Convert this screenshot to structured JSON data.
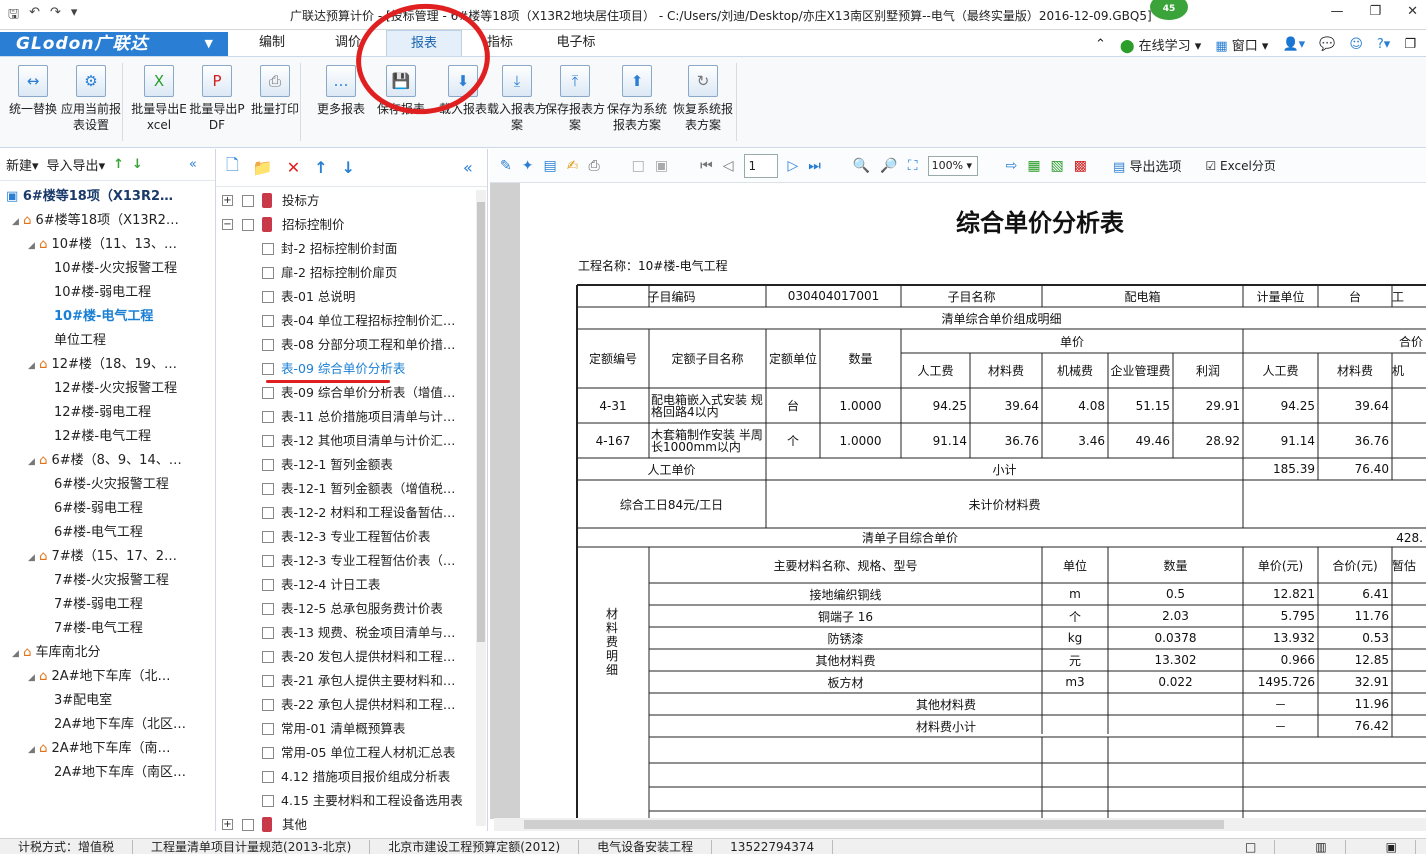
{
  "window": {
    "title": "广联达预算计价 - [投标管理 - 6#楼等18项（X13R2地块居住项目） - C:/Users/刘迪/Desktop/亦庄X13南区别墅预算--电气（最终实量版）2016-12-09.GBQ5]",
    "badge": "45"
  },
  "brand": {
    "logo": "GLodon广联达"
  },
  "menu": {
    "tabs": [
      "编制",
      "调价",
      "报表",
      "指标",
      "电子标"
    ],
    "active": "报表",
    "online": "在线学习",
    "window": "窗口"
  },
  "ribbon": {
    "buttons": [
      "统一替换",
      "应用当前报表设置",
      "批量导出Excel",
      "批量导出PDF",
      "批量打印",
      "更多报表",
      "保存报表",
      "载入报表",
      "载入报表方案",
      "保存报表方案",
      "保存为系统报表方案",
      "恢复系统报表方案"
    ]
  },
  "project_tree": {
    "toolbar": {
      "new": "新建",
      "import_export": "导入导出"
    },
    "root": "6#楼等18项（X13R2…",
    "nodes": [
      {
        "label": "6#楼等18项（X13R2…",
        "level": 1,
        "type": "home"
      },
      {
        "label": "10#楼（11、13、…",
        "level": 2,
        "type": "home"
      },
      {
        "label": "10#楼-火灾报警工程",
        "level": 3
      },
      {
        "label": "10#楼-弱电工程",
        "level": 3
      },
      {
        "label": "10#楼-电气工程",
        "level": 3,
        "selected": true
      },
      {
        "label": "单位工程",
        "level": 3
      },
      {
        "label": "12#楼（18、19、…",
        "level": 2,
        "type": "home"
      },
      {
        "label": "12#楼-火灾报警工程",
        "level": 3
      },
      {
        "label": "12#楼-弱电工程",
        "level": 3
      },
      {
        "label": "12#楼-电气工程",
        "level": 3
      },
      {
        "label": "6#楼（8、9、14、…",
        "level": 2,
        "type": "home"
      },
      {
        "label": "6#楼-火灾报警工程",
        "level": 3
      },
      {
        "label": "6#楼-弱电工程",
        "level": 3
      },
      {
        "label": "6#楼-电气工程",
        "level": 3
      },
      {
        "label": "7#楼（15、17、2…",
        "level": 2,
        "type": "home"
      },
      {
        "label": "7#楼-火灾报警工程",
        "level": 3
      },
      {
        "label": "7#楼-弱电工程",
        "level": 3
      },
      {
        "label": "7#楼-电气工程",
        "level": 3
      },
      {
        "label": "车库南北分",
        "level": 1,
        "type": "home"
      },
      {
        "label": "2A#地下车库（北…",
        "level": 2,
        "type": "home"
      },
      {
        "label": "3#配电室",
        "level": 3
      },
      {
        "label": "2A#地下车库（北区…",
        "level": 3
      },
      {
        "label": "2A#地下车库（南…",
        "level": 2,
        "type": "home"
      },
      {
        "label": "2A#地下车库（南区…",
        "level": 3
      }
    ]
  },
  "report_list": {
    "items": [
      {
        "label": "投标方",
        "group": true
      },
      {
        "label": "招标控制价",
        "group": true
      },
      {
        "label": "封-2 招标控制价封面"
      },
      {
        "label": "扉-2 招标控制价扉页"
      },
      {
        "label": "表-01 总说明"
      },
      {
        "label": "表-04 单位工程招标控制价汇…"
      },
      {
        "label": "表-08 分部分项工程和单价措…"
      },
      {
        "label": "表-09 综合单价分析表",
        "active": true
      },
      {
        "label": "表-09 综合单价分析表（增值…"
      },
      {
        "label": "表-11 总价措施项目清单与计…"
      },
      {
        "label": "表-12 其他项目清单与计价汇…"
      },
      {
        "label": "表-12-1 暂列金额表"
      },
      {
        "label": "表-12-1 暂列金额表（增值税…"
      },
      {
        "label": "表-12-2 材料和工程设备暂估…"
      },
      {
        "label": "表-12-3 专业工程暂估价表"
      },
      {
        "label": "表-12-3 专业工程暂估价表（…"
      },
      {
        "label": "表-12-4 计日工表"
      },
      {
        "label": "表-12-5 总承包服务费计价表"
      },
      {
        "label": "表-13 规费、税金项目清单与…"
      },
      {
        "label": "表-20 发包人提供材料和工程…"
      },
      {
        "label": "表-21 承包人提供主要材料和…"
      },
      {
        "label": "表-22 承包人提供材料和工程…"
      },
      {
        "label": "常用-01 清单概预算表"
      },
      {
        "label": "常用-05 单位工程人材机汇总表"
      },
      {
        "label": "4.12 措施项目报价组成分析表"
      },
      {
        "label": "4.15 主要材料和工程设备选用表"
      },
      {
        "label": "其他",
        "group": true
      }
    ]
  },
  "preview": {
    "page": "1",
    "zoom": "100%",
    "export_options": "导出选项",
    "excel_paging": "Excel分页",
    "title": "综合单价分析表",
    "project_name": "工程名称：10#楼-电气工程",
    "header": {
      "code_label": "子目编码",
      "code": "030404017001",
      "name_label": "子目名称",
      "name": "配电箱",
      "unit_label": "计量单位",
      "unit": "台",
      "extra": "工"
    },
    "detail_title": "清单综合单价组成明细",
    "cols": {
      "quota_no": "定额编号",
      "quota_name": "定额子目名称",
      "quota_unit": "定额单位",
      "qty": "数量",
      "unit_price": "单价",
      "total_price": "合价",
      "labor": "人工费",
      "material": "材料费",
      "machine": "机械费",
      "mgmt": "企业管理费",
      "profit": "利润",
      "machine_short": "机"
    },
    "rows": [
      {
        "no": "4-31",
        "name": "配电箱嵌入式安装 规格回路4以内",
        "unit": "台",
        "qty": "1.0000",
        "labor": "94.25",
        "material": "39.64",
        "machine": "4.08",
        "mgmt": "51.15",
        "profit": "29.91",
        "t_labor": "94.25",
        "t_material": "39.64"
      },
      {
        "no": "4-167",
        "name": "木套箱制作安装 半周长1000mm以内",
        "unit": "个",
        "qty": "1.0000",
        "labor": "91.14",
        "material": "36.76",
        "machine": "3.46",
        "mgmt": "49.46",
        "profit": "28.92",
        "t_labor": "91.14",
        "t_material": "36.76"
      }
    ],
    "labor_unit_price": "人工单价",
    "subtotal": "小计",
    "subtotal_labor": "185.39",
    "subtotal_material": "76.40",
    "labor_day": "综合工日84元/工日",
    "unpriced_material": "未计价材料费",
    "item_total": "清单子目综合单价",
    "item_total_value": "428.",
    "mat_header": {
      "name": "主要材料名称、规格、型号",
      "unit": "单位",
      "qty": "数量",
      "price": "单价(元)",
      "total": "合价(元)",
      "est": "暂估"
    },
    "mat_side": "材料费明细",
    "materials": [
      {
        "name": "接地编织铜线",
        "unit": "m",
        "qty": "0.5",
        "price": "12.821",
        "total": "6.41"
      },
      {
        "name": "铜端子 16",
        "unit": "个",
        "qty": "2.03",
        "price": "5.795",
        "total": "11.76"
      },
      {
        "name": "防锈漆",
        "unit": "kg",
        "qty": "0.0378",
        "price": "13.932",
        "total": "0.53"
      },
      {
        "name": "其他材料费",
        "unit": "元",
        "qty": "13.302",
        "price": "0.966",
        "total": "12.85"
      },
      {
        "name": "板方材",
        "unit": "m3",
        "qty": "0.022",
        "price": "1495.726",
        "total": "32.91"
      }
    ],
    "other_material": "其他材料费",
    "other_material_price": "－",
    "other_material_total": "11.96",
    "material_subtotal": "材料费小计",
    "material_subtotal_price": "－",
    "material_subtotal_total": "76.42"
  },
  "status": [
    "计税方式：增值税",
    "工程量清单项目计量规范(2013-北京)",
    "北京市建设工程预算定额(2012)",
    "电气设备安装工程",
    "13522794374"
  ]
}
